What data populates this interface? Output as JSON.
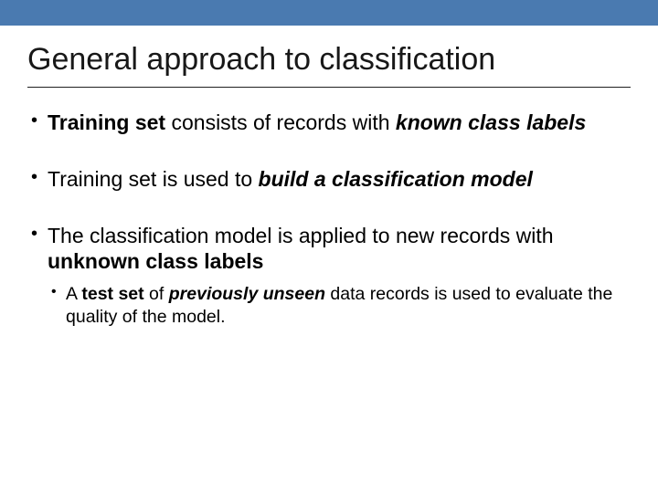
{
  "title": "General approach to classification",
  "bullets": {
    "b1": {
      "t1": "Training set",
      "t2": " consists of records with ",
      "t3": "known class labels"
    },
    "b2": {
      "t1": "Training set is used to ",
      "t2": "build a classification model"
    },
    "b3": {
      "t1": "The classification model is applied to new records with ",
      "t2": "unknown class labels",
      "sub": {
        "t1": "A ",
        "t2": "test set",
        "t3": " of ",
        "t4": "previously unseen",
        "t5": " data records is used to evaluate the quality of the model."
      }
    }
  }
}
